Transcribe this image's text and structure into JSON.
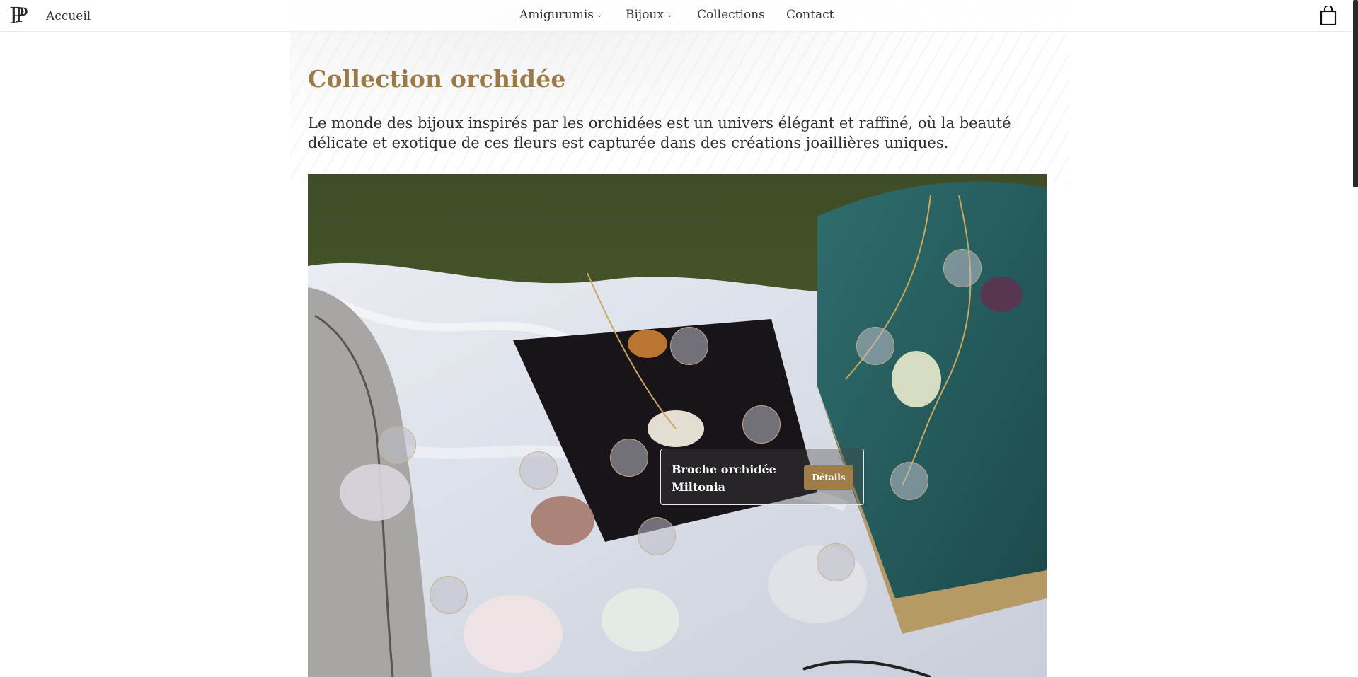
{
  "header": {
    "logo_text": "P",
    "home_label": "Accueil",
    "nav": [
      {
        "label": "Amigurumis",
        "has_dropdown": true
      },
      {
        "label": "Bijoux",
        "has_dropdown": true
      },
      {
        "label": "Collections",
        "has_dropdown": false
      },
      {
        "label": "Contact",
        "has_dropdown": false
      }
    ],
    "cart_icon": "shopping-bag-icon"
  },
  "main": {
    "title": "Collection orchidée",
    "description": "Le monde des bijoux inspirés par les orchidées est un univers élégant et raffiné, où la beauté délicate et exotique de ces fleurs est capturée dans des créations joaillières uniques."
  },
  "tooltip": {
    "product_name": "Broche orchidée Miltonia",
    "details_label": "Détails"
  },
  "colors": {
    "accent": "#9b7a45",
    "button": "#a07d47",
    "text": "#2e2e2e"
  }
}
